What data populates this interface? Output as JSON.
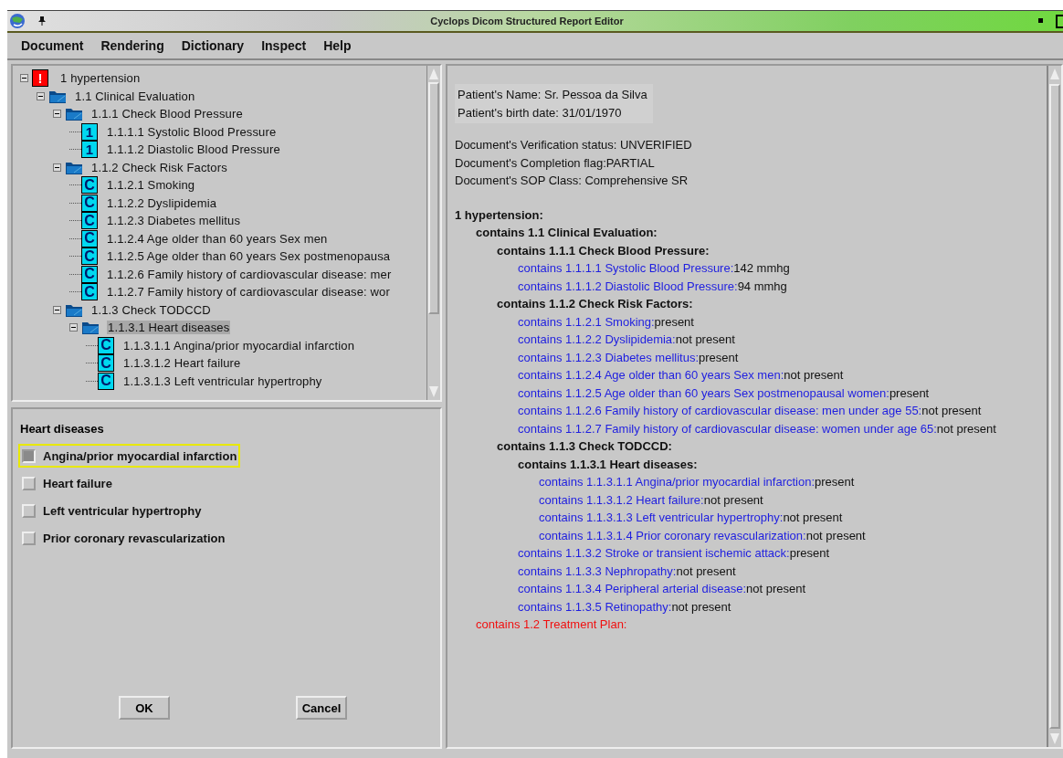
{
  "window": {
    "title": "Cyclops Dicom Structured Report Editor"
  },
  "menu": [
    "Document",
    "Rendering",
    "Dictionary",
    "Inspect",
    "Help"
  ],
  "tree": [
    {
      "kind": "alert",
      "icon_text": "!",
      "label": "1 hypertension",
      "selected": false,
      "expanded": true,
      "children": [
        {
          "kind": "container",
          "label": "1.1 Clinical Evaluation",
          "selected": false,
          "expanded": true,
          "children": [
            {
              "kind": "container",
              "label": "1.1.1 Check Blood Pressure",
              "selected": false,
              "expanded": true,
              "children": [
                {
                  "kind": "num",
                  "icon_text": "1",
                  "label": "1.1.1.1 Systolic Blood Pressure",
                  "selected": false
                },
                {
                  "kind": "num",
                  "icon_text": "1",
                  "label": "1.1.1.2 Diastolic Blood Pressure",
                  "selected": false
                }
              ]
            },
            {
              "kind": "container",
              "label": "1.1.2 Check Risk Factors",
              "selected": false,
              "expanded": true,
              "children": [
                {
                  "kind": "code",
                  "icon_text": "C",
                  "label": "1.1.2.1 Smoking",
                  "selected": false
                },
                {
                  "kind": "code",
                  "icon_text": "C",
                  "label": "1.1.2.2 Dyslipidemia",
                  "selected": false
                },
                {
                  "kind": "code",
                  "icon_text": "C",
                  "label": "1.1.2.3 Diabetes mellitus",
                  "selected": false
                },
                {
                  "kind": "code",
                  "icon_text": "C",
                  "label": "1.1.2.4 Age older than 60 years Sex men",
                  "selected": false
                },
                {
                  "kind": "code",
                  "icon_text": "C",
                  "label": "1.1.2.5 Age older than 60 years Sex postmenopausa",
                  "selected": false
                },
                {
                  "kind": "code",
                  "icon_text": "C",
                  "label": "1.1.2.6 Family history of cardiovascular disease: mer",
                  "selected": false
                },
                {
                  "kind": "code",
                  "icon_text": "C",
                  "label": "1.1.2.7 Family history of cardiovascular disease: wor",
                  "selected": false
                }
              ]
            },
            {
              "kind": "container",
              "label": "1.1.3 Check TODCCD",
              "selected": false,
              "expanded": true,
              "children": [
                {
                  "kind": "container",
                  "label": "1.1.3.1 Heart diseases",
                  "selected": true,
                  "expanded": true,
                  "children": [
                    {
                      "kind": "code",
                      "icon_text": "C",
                      "label": "1.1.3.1.1 Angina/prior myocardial infarction",
                      "selected": false
                    },
                    {
                      "kind": "code",
                      "icon_text": "C",
                      "label": "1.1.3.1.2 Heart failure",
                      "selected": false
                    },
                    {
                      "kind": "code",
                      "icon_text": "C",
                      "label": "1.1.3.1.3 Left ventricular hypertrophy",
                      "selected": false
                    }
                  ]
                }
              ]
            }
          ]
        }
      ]
    }
  ],
  "form": {
    "title": "Heart diseases",
    "options": [
      {
        "label": "Angina/prior myocardial infarction",
        "checked": true,
        "focused": true
      },
      {
        "label": "Heart failure",
        "checked": false,
        "focused": false
      },
      {
        "label": "Left ventricular hypertrophy",
        "checked": false,
        "focused": false
      },
      {
        "label": "Prior coronary revascularization",
        "checked": false,
        "focused": false
      }
    ],
    "buttons": [
      "OK",
      "Cancel"
    ]
  },
  "report": {
    "patient": [
      "Patient's Name: Sr. Pessoa da Silva",
      "Patient's birth date:  31/01/1970"
    ],
    "status": [
      "Document's Verification status: UNVERIFIED",
      "Document's Completion flag:PARTIAL",
      "Document's SOP Class: Comprehensive SR"
    ],
    "items": [
      {
        "kind": "heading",
        "label": "1 hypertension:",
        "children": [
          {
            "kind": "heading",
            "label": "contains 1.1 Clinical Evaluation:",
            "children": [
              {
                "kind": "heading",
                "label": "contains 1.1.1 Check Blood Pressure:",
                "children": [
                  {
                    "kind": "item",
                    "label": "contains 1.1.1.1 Systolic Blood Pressure:",
                    "value": "142 mmhg"
                  },
                  {
                    "kind": "item",
                    "label": "contains 1.1.1.2 Diastolic Blood Pressure:",
                    "value": "94 mmhg"
                  }
                ]
              },
              {
                "kind": "heading",
                "label": "contains 1.1.2 Check Risk Factors:",
                "children": [
                  {
                    "kind": "item",
                    "label": "contains 1.1.2.1 Smoking:",
                    "value": "present"
                  },
                  {
                    "kind": "item",
                    "label": "contains 1.1.2.2 Dyslipidemia:",
                    "value": "not present"
                  },
                  {
                    "kind": "item",
                    "label": "contains 1.1.2.3 Diabetes mellitus:",
                    "value": "present"
                  },
                  {
                    "kind": "item",
                    "label": "contains 1.1.2.4 Age older than 60 years Sex men:",
                    "value": "not present"
                  },
                  {
                    "kind": "item",
                    "label": "contains 1.1.2.5 Age older than 60 years Sex postmenopausal women:",
                    "value": "present"
                  },
                  {
                    "kind": "item",
                    "label": "contains 1.1.2.6 Family history of cardiovascular disease: men under age 55:",
                    "value": "not present"
                  },
                  {
                    "kind": "item",
                    "label": "contains 1.1.2.7 Family history of cardiovascular disease: women under age 65:",
                    "value": "not present"
                  }
                ]
              },
              {
                "kind": "heading",
                "label": "contains 1.1.3 Check TODCCD:",
                "children": [
                  {
                    "kind": "heading",
                    "label": "contains 1.1.3.1 Heart diseases:",
                    "children": [
                      {
                        "kind": "item",
                        "label": "contains 1.1.3.1.1 Angina/prior myocardial infarction:",
                        "value": "present"
                      },
                      {
                        "kind": "item",
                        "label": "contains 1.1.3.1.2 Heart failure:",
                        "value": "not present"
                      },
                      {
                        "kind": "item",
                        "label": "contains 1.1.3.1.3 Left ventricular hypertrophy:",
                        "value": "not present"
                      },
                      {
                        "kind": "item",
                        "label": "contains 1.1.3.1.4 Prior coronary revascularization:",
                        "value": "not present"
                      }
                    ]
                  },
                  {
                    "kind": "item",
                    "label": "contains 1.1.3.2 Stroke or transient ischemic attack:",
                    "value": "present"
                  },
                  {
                    "kind": "item",
                    "label": "contains 1.1.3.3 Nephropathy:",
                    "value": "not present"
                  },
                  {
                    "kind": "item",
                    "label": "contains 1.1.3.4 Peripheral arterial disease:",
                    "value": "not present"
                  },
                  {
                    "kind": "item",
                    "label": "contains 1.1.3.5 Retinopathy:",
                    "value": "not present"
                  }
                ]
              }
            ]
          },
          {
            "kind": "pending",
            "label": "contains 1.2 Treatment Plan:"
          }
        ]
      }
    ]
  }
}
